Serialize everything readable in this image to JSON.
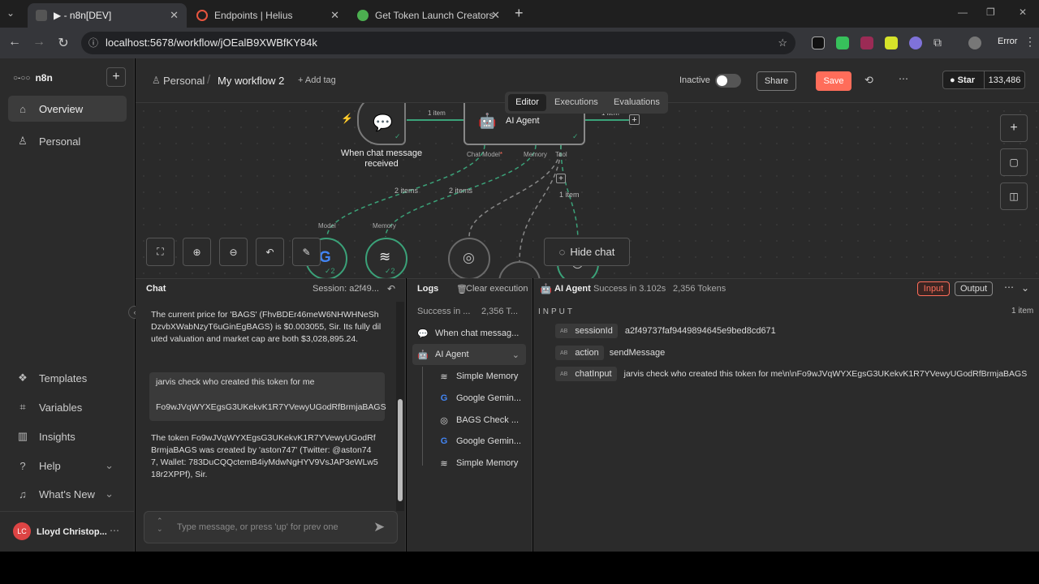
{
  "browser": {
    "tabs": [
      {
        "title": "▶ - n8n[DEV]",
        "active": true
      },
      {
        "title": "Endpoints | Helius",
        "active": false
      },
      {
        "title": "Get Token Launch Creators - Ba",
        "active": false
      }
    ],
    "url": "localhost:5678/workflow/jOEalB9XWBfKY84k",
    "profile_status": "Error"
  },
  "sidebar": {
    "logo": "n8n",
    "items": [
      {
        "label": "Overview",
        "icon": "home-icon",
        "active": true
      },
      {
        "label": "Personal",
        "icon": "user-icon",
        "active": false
      }
    ],
    "bottom_items": [
      {
        "label": "Templates",
        "icon": "templates-icon"
      },
      {
        "label": "Variables",
        "icon": "variables-icon"
      },
      {
        "label": "Insights",
        "icon": "insights-icon"
      },
      {
        "label": "Help",
        "icon": "help-icon"
      },
      {
        "label": "What's New",
        "icon": "bell-icon"
      }
    ],
    "user": {
      "initials": "LC",
      "name": "Lloyd Christop..."
    }
  },
  "header": {
    "breadcrumb_project": "Personal",
    "workflow_name": "My workflow 2",
    "add_tag": "+ Add tag",
    "status_label": "Inactive",
    "share": "Share",
    "save": "Save",
    "github_star": "Star",
    "github_count": "133,486"
  },
  "canvas_tabs": [
    "Editor",
    "Executions",
    "Evaluations"
  ],
  "canvas": {
    "trigger_label": "When chat message received",
    "agent_label": "AI Agent",
    "edge_label_main": "1 item",
    "edge_label_out": "1 item",
    "port_chat_model": "Chat Model",
    "port_memory": "Memory",
    "port_tool": "Tool",
    "edge_2items_a": "2 items",
    "edge_2items_b": "2 items",
    "edge_1item_tool": "1 item",
    "sub_model": "Model",
    "sub_memory": "Memory",
    "badge_model": "2",
    "badge_memory": "2",
    "hide_chat": "Hide chat"
  },
  "chat": {
    "title": "Chat",
    "session": "Session: a2f49...",
    "messages": [
      {
        "role": "bot",
        "text": "The current price for 'BAGS' (FhvBDEr46meW6NHWHNeShDzvbXWabNzyT6uGinEgBAGS) is $0.003055, Sir. Its fully diluted valuation and market cap are both $3,028,895.24."
      },
      {
        "role": "user",
        "line1": "jarvis check who created this token for me",
        "line2": "Fo9wJVqWYXEgsG3UKekvK1R7YVewyUGodRfBrmjaBAGS"
      },
      {
        "role": "bot",
        "text": "The token Fo9wJVqWYXEgsG3UKekvK1R7YVewyUGodRfBrmjaBAGS was created by 'aston747' (Twitter: @aston747, Wallet: 783DuCQQctemB4iyMdwNgHYV9VsJAP3eWLw518r2XPPf), Sir."
      }
    ],
    "input_placeholder": "Type message, or press 'up' for prev one"
  },
  "logs": {
    "title": "Logs",
    "clear": "Clear execution",
    "summary_status": "Success in ...",
    "summary_tokens": "2,356 T...",
    "tree": [
      {
        "label": "When chat messag...",
        "icon": "chat-icon",
        "level": 0
      },
      {
        "label": "AI Agent",
        "icon": "robot-icon",
        "level": 0,
        "selected": true
      },
      {
        "label": "Simple Memory",
        "icon": "database-icon",
        "level": 1
      },
      {
        "label": "Google Gemin...",
        "icon": "google-icon",
        "level": 1
      },
      {
        "label": "BAGS Check ...",
        "icon": "globe-icon",
        "level": 1
      },
      {
        "label": "Google Gemin...",
        "icon": "google-icon",
        "level": 1
      },
      {
        "label": "Simple Memory",
        "icon": "database-icon",
        "level": 1
      }
    ]
  },
  "detail": {
    "node": "AI Agent",
    "status": "Success in 3.102s",
    "tokens": "2,356 Tokens",
    "tab_input": "Input",
    "tab_output": "Output",
    "section": "INPUT",
    "count": "1 item",
    "type_tag": "AB",
    "fields": [
      {
        "key": "sessionId",
        "value": "a2f49737faf9449894645e9bed8cd671"
      },
      {
        "key": "action",
        "value": "sendMessage"
      },
      {
        "key": "chatInput",
        "value": "jarvis check who created this token for me\\n\\nFo9wJVqWYXEgsG3UKekvK1R7YVewyUGodRfBrmjaBAGS"
      }
    ]
  },
  "colors": {
    "accent": "#ff6d5a",
    "edge_green": "#3ba279",
    "bg": "#2b2b2b"
  }
}
